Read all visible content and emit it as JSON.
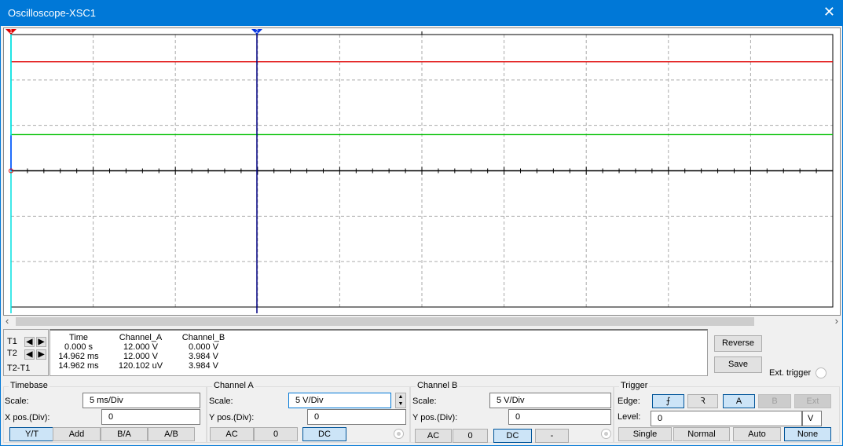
{
  "window": {
    "title": "Oscilloscope-XSC1",
    "close_icon": "close-icon"
  },
  "screen": {
    "h_divisions": 10,
    "v_divisions": 6,
    "time_per_div_ms": 5,
    "volts_per_div_a": 5,
    "volts_per_div_b": 5,
    "traces": [
      {
        "channel": "A",
        "level_v": 12.0,
        "color": "#e00000"
      },
      {
        "channel": "B",
        "level_v": 3.984,
        "color": "#00c000"
      }
    ],
    "cursors": [
      {
        "label": "1",
        "time_ms": 0.0,
        "color": "#00e0e0",
        "marker_color": "#e00000"
      },
      {
        "label": "2",
        "time_ms": 14.962,
        "color": "#000080",
        "marker_color": "#0030e0"
      }
    ]
  },
  "cursor_panel": {
    "t1": "T1",
    "t2": "T2",
    "t2_t1": "T2-T1"
  },
  "readout": {
    "headers": [
      "Time",
      "Channel_A",
      "Channel_B"
    ],
    "rows": [
      [
        "0.000 s",
        "12.000 V",
        "0.000 V"
      ],
      [
        "14.962 ms",
        "12.000 V",
        "3.984 V"
      ],
      [
        "14.962 ms",
        "120.102 uV",
        "3.984 V"
      ]
    ]
  },
  "actions": {
    "reverse": "Reverse",
    "save": "Save",
    "ext_trigger": "Ext. trigger"
  },
  "timebase": {
    "title": "Timebase",
    "scale_label": "Scale:",
    "scale": "5 ms/Div",
    "xpos_label": "X pos.(Div):",
    "xpos": "0",
    "modes": [
      "Y/T",
      "Add",
      "B/A",
      "A/B"
    ],
    "active_mode": "Y/T"
  },
  "channel_a": {
    "title": "Channel A",
    "scale_label": "Scale:",
    "scale": "5  V/Div",
    "ypos_label": "Y pos.(Div):",
    "ypos": "0",
    "coupling": [
      "AC",
      "0",
      "DC"
    ],
    "active": "DC"
  },
  "channel_b": {
    "title": "Channel B",
    "scale_label": "Scale:",
    "scale": "5  V/Div",
    "ypos_label": "Y pos.(Div):",
    "ypos": "0",
    "coupling": [
      "AC",
      "0",
      "DC",
      "-"
    ],
    "active": "DC"
  },
  "trigger": {
    "title": "Trigger",
    "edge_label": "Edge:",
    "edge_rising": "⨍",
    "edge_falling": "Ꝛ",
    "sources": [
      "A",
      "B",
      "Ext"
    ],
    "active_source": "A",
    "level_label": "Level:",
    "level": "0",
    "level_unit": "V",
    "modes": [
      "Single",
      "Normal",
      "Auto",
      "None"
    ],
    "active_mode": "None"
  }
}
